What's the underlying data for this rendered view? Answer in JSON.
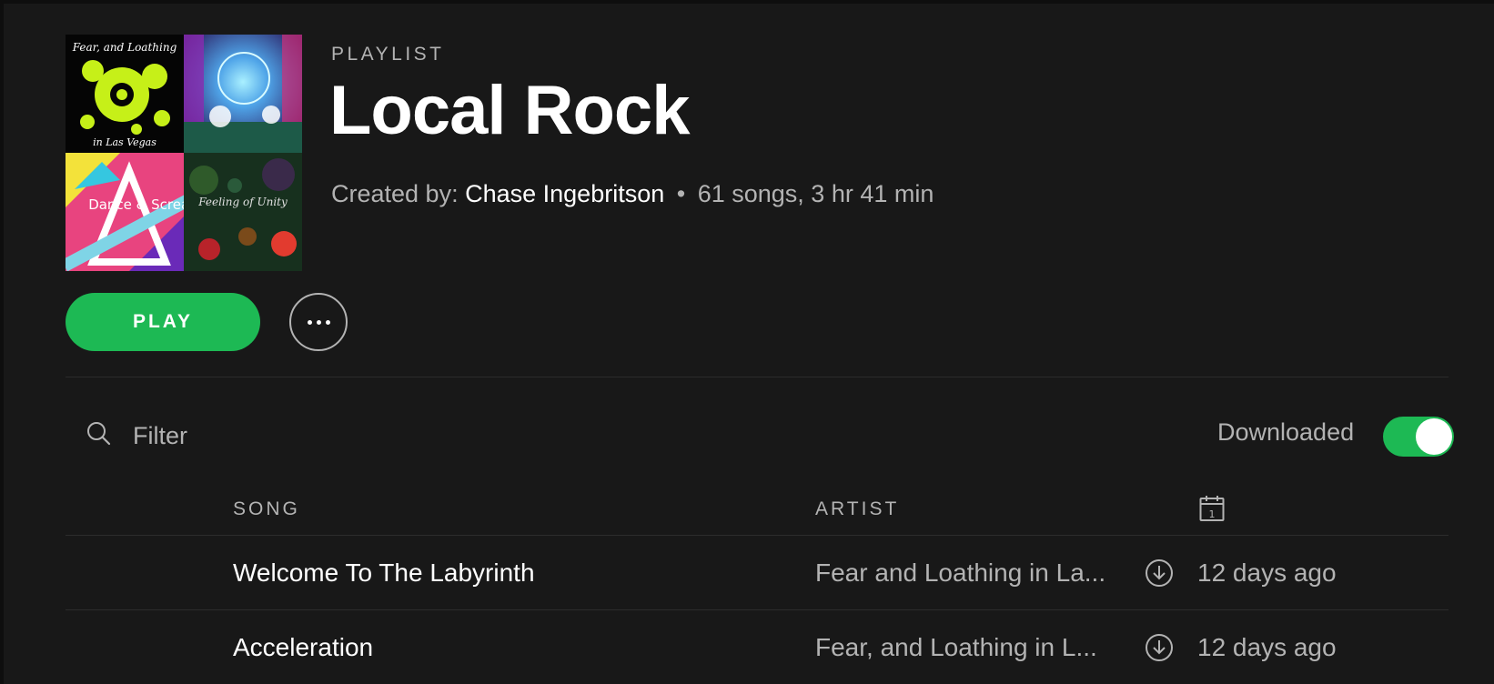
{
  "header": {
    "eyebrow": "PLAYLIST",
    "title": "Local Rock",
    "created_by_label": "Created by:",
    "owner": "Chase Ingebritson",
    "separator": "•",
    "stats": "61 songs, 3 hr 41 min",
    "cover_tiles": [
      {
        "name": "Fear, and Loathing in Las Vegas album art",
        "caption_top": "Fear, and Loathing",
        "caption_bottom": "in Las Vegas",
        "bg": "#050505",
        "accent": "#c6f018"
      },
      {
        "name": "space collage album art",
        "bg": "#2a1a5e",
        "accent": "#4fd0ff"
      },
      {
        "name": "Dance & Scream album art",
        "caption": "Dance & Scream",
        "bg": "#e8447f",
        "accent": "#35c7e0"
      },
      {
        "name": "Feeling of Unity album art",
        "caption": "Feeling of Unity",
        "bg": "#17301e",
        "accent": "#e23b2f"
      }
    ]
  },
  "actions": {
    "play_label": "PLAY",
    "more_icon": "ellipsis-icon"
  },
  "filter": {
    "placeholder": "Filter",
    "icon": "search-icon",
    "downloaded_label": "Downloaded",
    "downloaded_on": true
  },
  "table": {
    "columns": {
      "song": "SONG",
      "artist": "ARTIST",
      "date_icon": "calendar-icon",
      "calendar_day": "1"
    },
    "rows": [
      {
        "song": "Welcome To The Labyrinth",
        "artist": "Fear and Loathing in La...",
        "date": "12 days ago",
        "download_icon": "downloaded-icon"
      },
      {
        "song": "Acceleration",
        "artist": "Fear, and Loathing in L...",
        "date": "12 days ago",
        "download_icon": "downloaded-icon"
      }
    ]
  },
  "colors": {
    "background": "#181818",
    "accent_green": "#1db954",
    "text_primary": "#ffffff",
    "text_secondary": "#b3b3b3",
    "divider": "#2c2c2c"
  }
}
